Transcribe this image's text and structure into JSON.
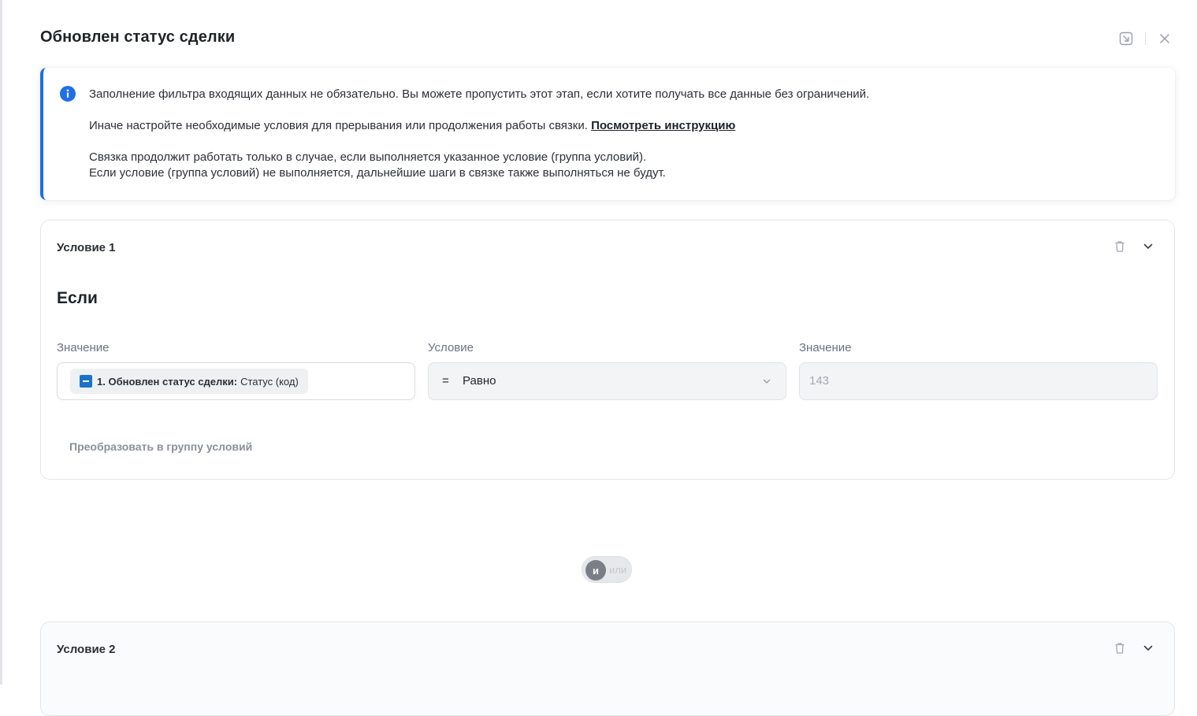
{
  "modal": {
    "title": "Обновлен статус сделки"
  },
  "info": {
    "line1": "Заполнение фильтра входящих данных не обязательно. Вы можете пропустить этот этап, если хотите получать все данные без ограничений.",
    "line2": "Иначе настройте необходимые условия для прерывания или продолжения работы связки.",
    "link": "Посмотреть инструкцию",
    "line3": "Связка продолжит работать только в случае, если выполняется указанное условие (группа условий).",
    "line4": "Если условие (группа условий) не выполняется, дальнейшие шаги в связке также выполняться не будут."
  },
  "conditions": [
    {
      "title": "Условие 1",
      "if_label": "Если",
      "value_label": "Значение",
      "condition_label": "Условие",
      "value2_label": "Значение",
      "chip_bold": "1. Обновлен статус сделки:",
      "chip_text": "Статус (код)",
      "operator_symbol": "=",
      "operator_text": "Равно",
      "value2_placeholder": "143",
      "convert_link": "Преобразовать в группу условий"
    },
    {
      "title": "Условие 2"
    }
  ],
  "toggle": {
    "active": "и",
    "inactive": "или"
  },
  "colors": {
    "accent": "#1f6fe5",
    "integration_logo": "#1a73c7"
  }
}
